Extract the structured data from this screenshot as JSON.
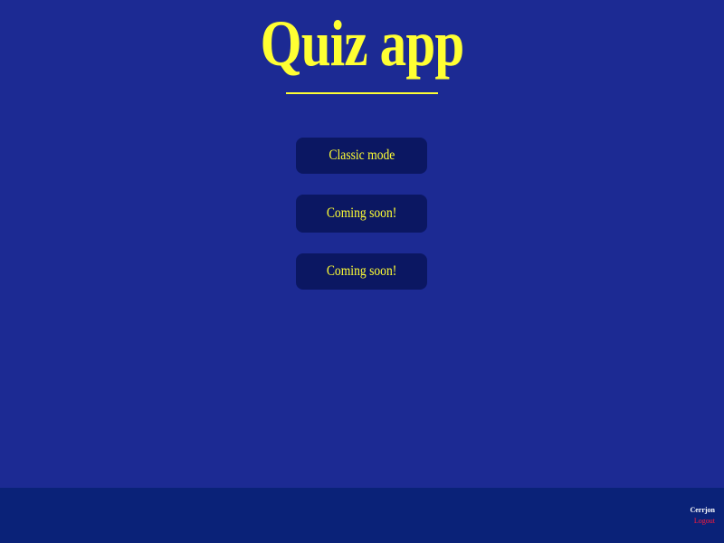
{
  "header": {
    "title": "Quiz app"
  },
  "modes": [
    {
      "label": "Classic mode"
    },
    {
      "label": "Coming soon!"
    },
    {
      "label": "Coming soon!"
    }
  ],
  "footer": {
    "username": "Cerrjon",
    "logout_label": "Logout"
  },
  "colors": {
    "background": "#1c2a93",
    "accent": "#ffff33",
    "button_bg": "#0b1762",
    "footer_bg": "#0a2278",
    "logout": "#ff1a3c"
  }
}
